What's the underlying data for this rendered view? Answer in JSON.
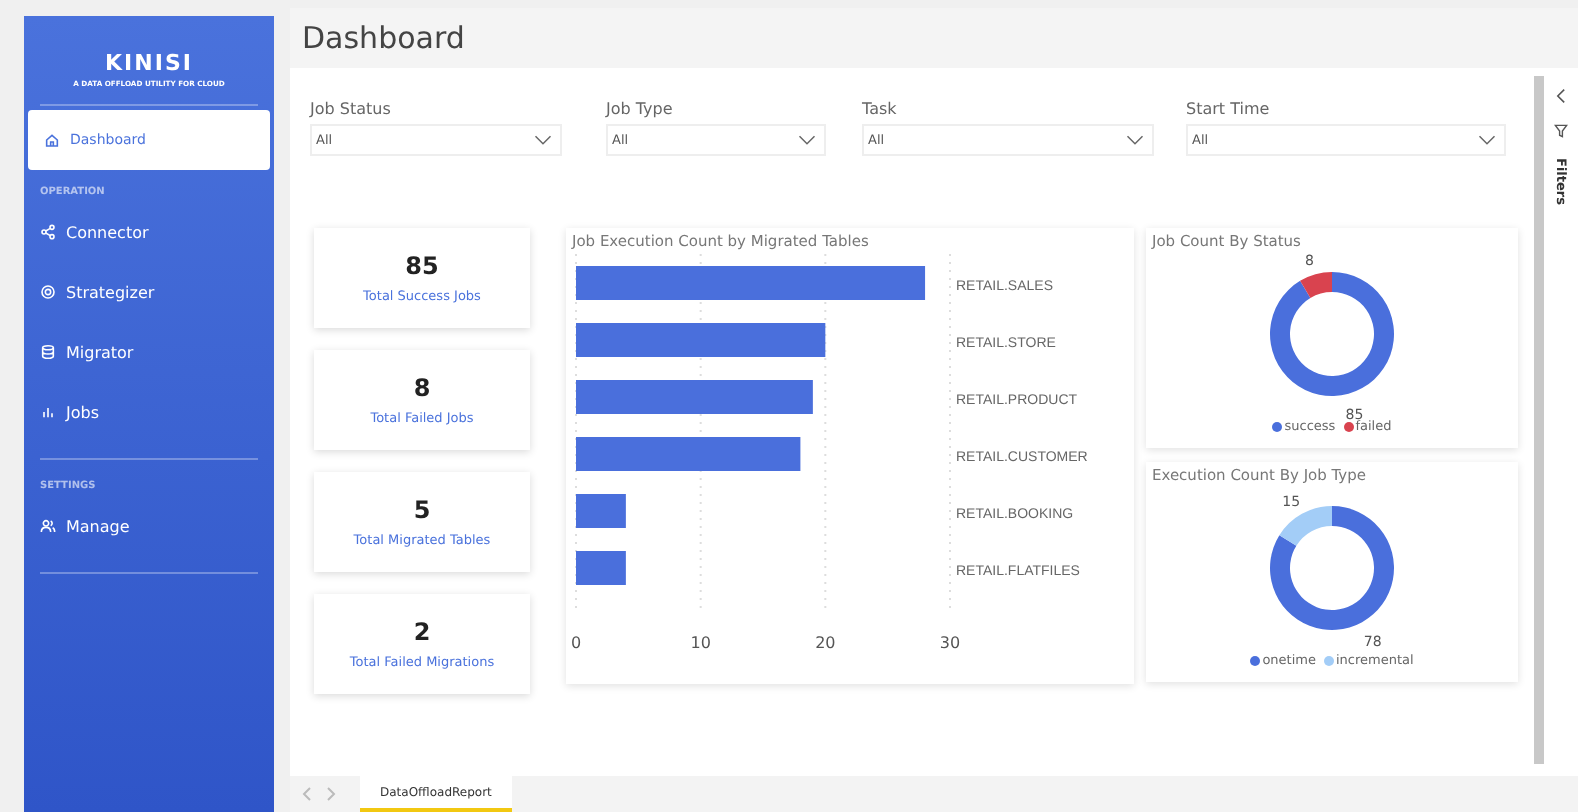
{
  "sidebar": {
    "logo": "KINISI",
    "tagline": "A DATA OFFLOAD UTILITY FOR CLOUD",
    "sections": [
      {
        "items": [
          {
            "label": "Dashboard",
            "selected": true
          }
        ]
      },
      {
        "heading": "OPERATION",
        "items": [
          {
            "label": "Connector",
            "selected": false
          },
          {
            "label": "Strategizer",
            "selected": false
          },
          {
            "label": "Migrator",
            "selected": false
          },
          {
            "label": "Jobs",
            "selected": false
          }
        ]
      },
      {
        "heading": "SETTINGS",
        "items": [
          {
            "label": "Manage",
            "selected": false
          }
        ]
      }
    ]
  },
  "page_title": "Dashboard",
  "filters": [
    {
      "label": "Job Status",
      "value": "All"
    },
    {
      "label": "Job Type",
      "value": "All"
    },
    {
      "label": "Task",
      "value": "All"
    },
    {
      "label": "Start Time",
      "value": "All"
    }
  ],
  "kpis": [
    {
      "value": "85",
      "label": "Total Success Jobs"
    },
    {
      "value": "8",
      "label": "Total Failed Jobs"
    },
    {
      "value": "5",
      "label": "Total Migrated Tables"
    },
    {
      "value": "2",
      "label": "Total Failed Migrations"
    }
  ],
  "bar_chart": {
    "chart_data": {
      "type": "bar",
      "orientation": "horizontal",
      "title": "Job Execution Count by Migrated Tables",
      "categories": [
        "RETAIL.SALES",
        "RETAIL.STORE",
        "RETAIL.PRODUCT",
        "RETAIL.CUSTOMER",
        "RETAIL.BOOKING",
        "RETAIL.FLATFILES"
      ],
      "values": [
        28,
        20,
        19,
        18,
        4,
        4
      ],
      "xlim": [
        0,
        30
      ],
      "xticks": [
        0,
        10,
        20,
        30
      ]
    }
  },
  "donuts": [
    {
      "chart_data": {
        "type": "donut",
        "title": "Job Count By Status",
        "categories": [
          "success",
          "failed"
        ],
        "values": [
          85,
          8
        ],
        "colors": [
          "#4a6fdc",
          "#d9434f"
        ],
        "data_labels": true,
        "legend": "bottom"
      }
    },
    {
      "chart_data": {
        "type": "donut",
        "title": "Execution Count By Job Type",
        "categories": [
          "onetime",
          "incremental"
        ],
        "values": [
          78,
          15
        ],
        "colors": [
          "#4a6fdc",
          "#a3cdf7"
        ],
        "data_labels": true,
        "legend": "bottom"
      }
    }
  ],
  "filters_pane": {
    "label": "Filters"
  },
  "page_tabs": [
    {
      "label": "DataOffloadReport",
      "selected": true
    }
  ]
}
